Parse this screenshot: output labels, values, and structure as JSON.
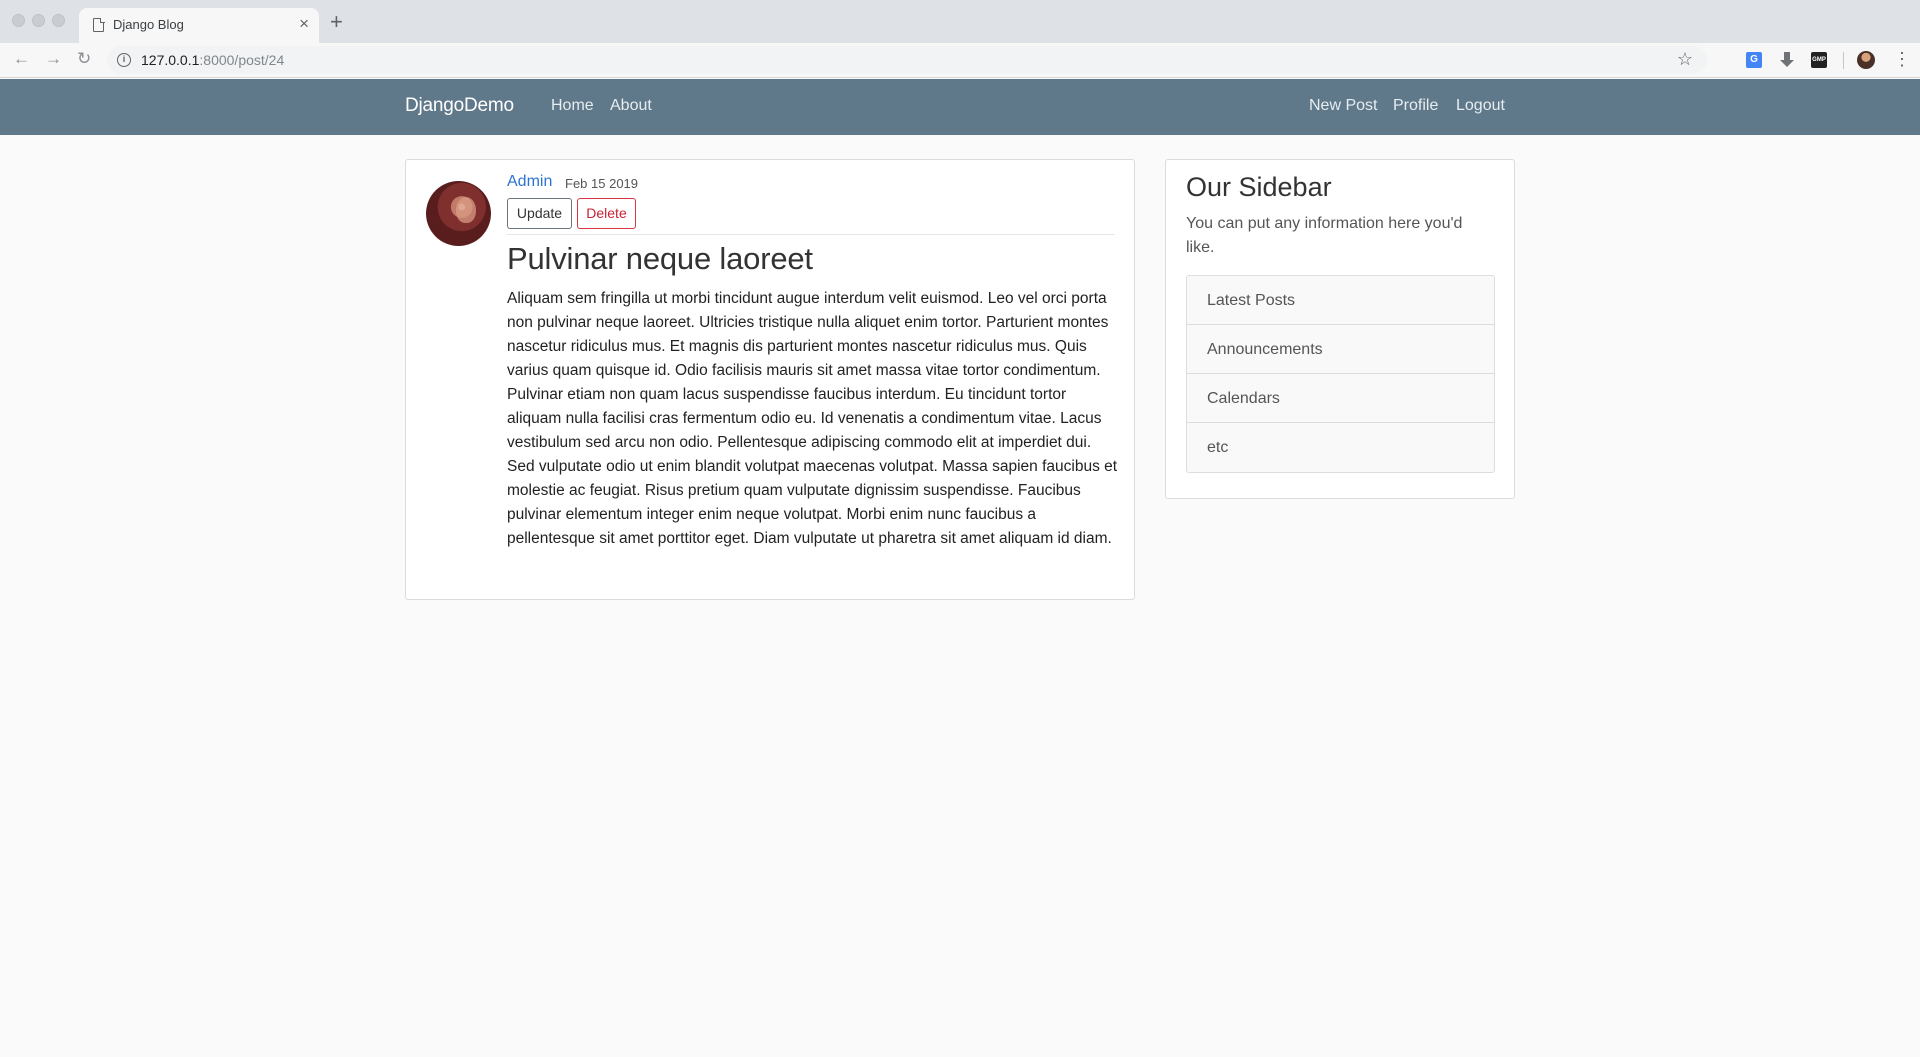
{
  "browser": {
    "tab_title": "Django Blog",
    "tab_close": "×",
    "new_tab": "+",
    "url_host": "127.0.0.1",
    "url_rest": ":8000/post/24",
    "ext_translate": "G",
    "ext_gmp": "GMP"
  },
  "navbar": {
    "brand": "DjangoDemo",
    "left_links": [
      "Home",
      "About"
    ],
    "right_links": [
      "New Post",
      "Profile",
      "Logout"
    ]
  },
  "post": {
    "author": "Admin",
    "date": "Feb 15 2019",
    "update_label": "Update",
    "delete_label": "Delete",
    "title": "Pulvinar neque laoreet",
    "content": "Aliquam sem fringilla ut morbi tincidunt augue interdum velit euismod. Leo vel orci porta non pulvinar neque laoreet. Ultricies tristique nulla aliquet enim tortor. Parturient montes nascetur ridiculus mus. Et magnis dis parturient montes nascetur ridiculus mus. Quis varius quam quisque id. Odio facilisis mauris sit amet massa vitae tortor condimentum. Pulvinar etiam non quam lacus suspendisse faucibus interdum. Eu tincidunt tortor aliquam nulla facilisi cras fermentum odio eu. Id venenatis a condimentum vitae. Lacus vestibulum sed arcu non odio. Pellentesque adipiscing commodo elit at imperdiet dui. Sed vulputate odio ut enim blandit volutpat maecenas volutpat. Massa sapien faucibus et molestie ac feugiat. Risus pretium quam vulputate dignissim suspendisse. Faucibus pulvinar elementum integer enim neque volutpat. Morbi enim nunc faucibus a pellentesque sit amet porttitor eget. Diam vulputate ut pharetra sit amet aliquam id diam."
  },
  "sidebar": {
    "title": "Our Sidebar",
    "description": "You can put any information here you'd like.",
    "items": [
      "Latest Posts",
      "Announcements",
      "Calendars",
      "etc"
    ]
  },
  "colors": {
    "navbar": "#5f788a",
    "link": "#2c73d2",
    "danger": "#dc3545",
    "background": "#fafafa"
  }
}
